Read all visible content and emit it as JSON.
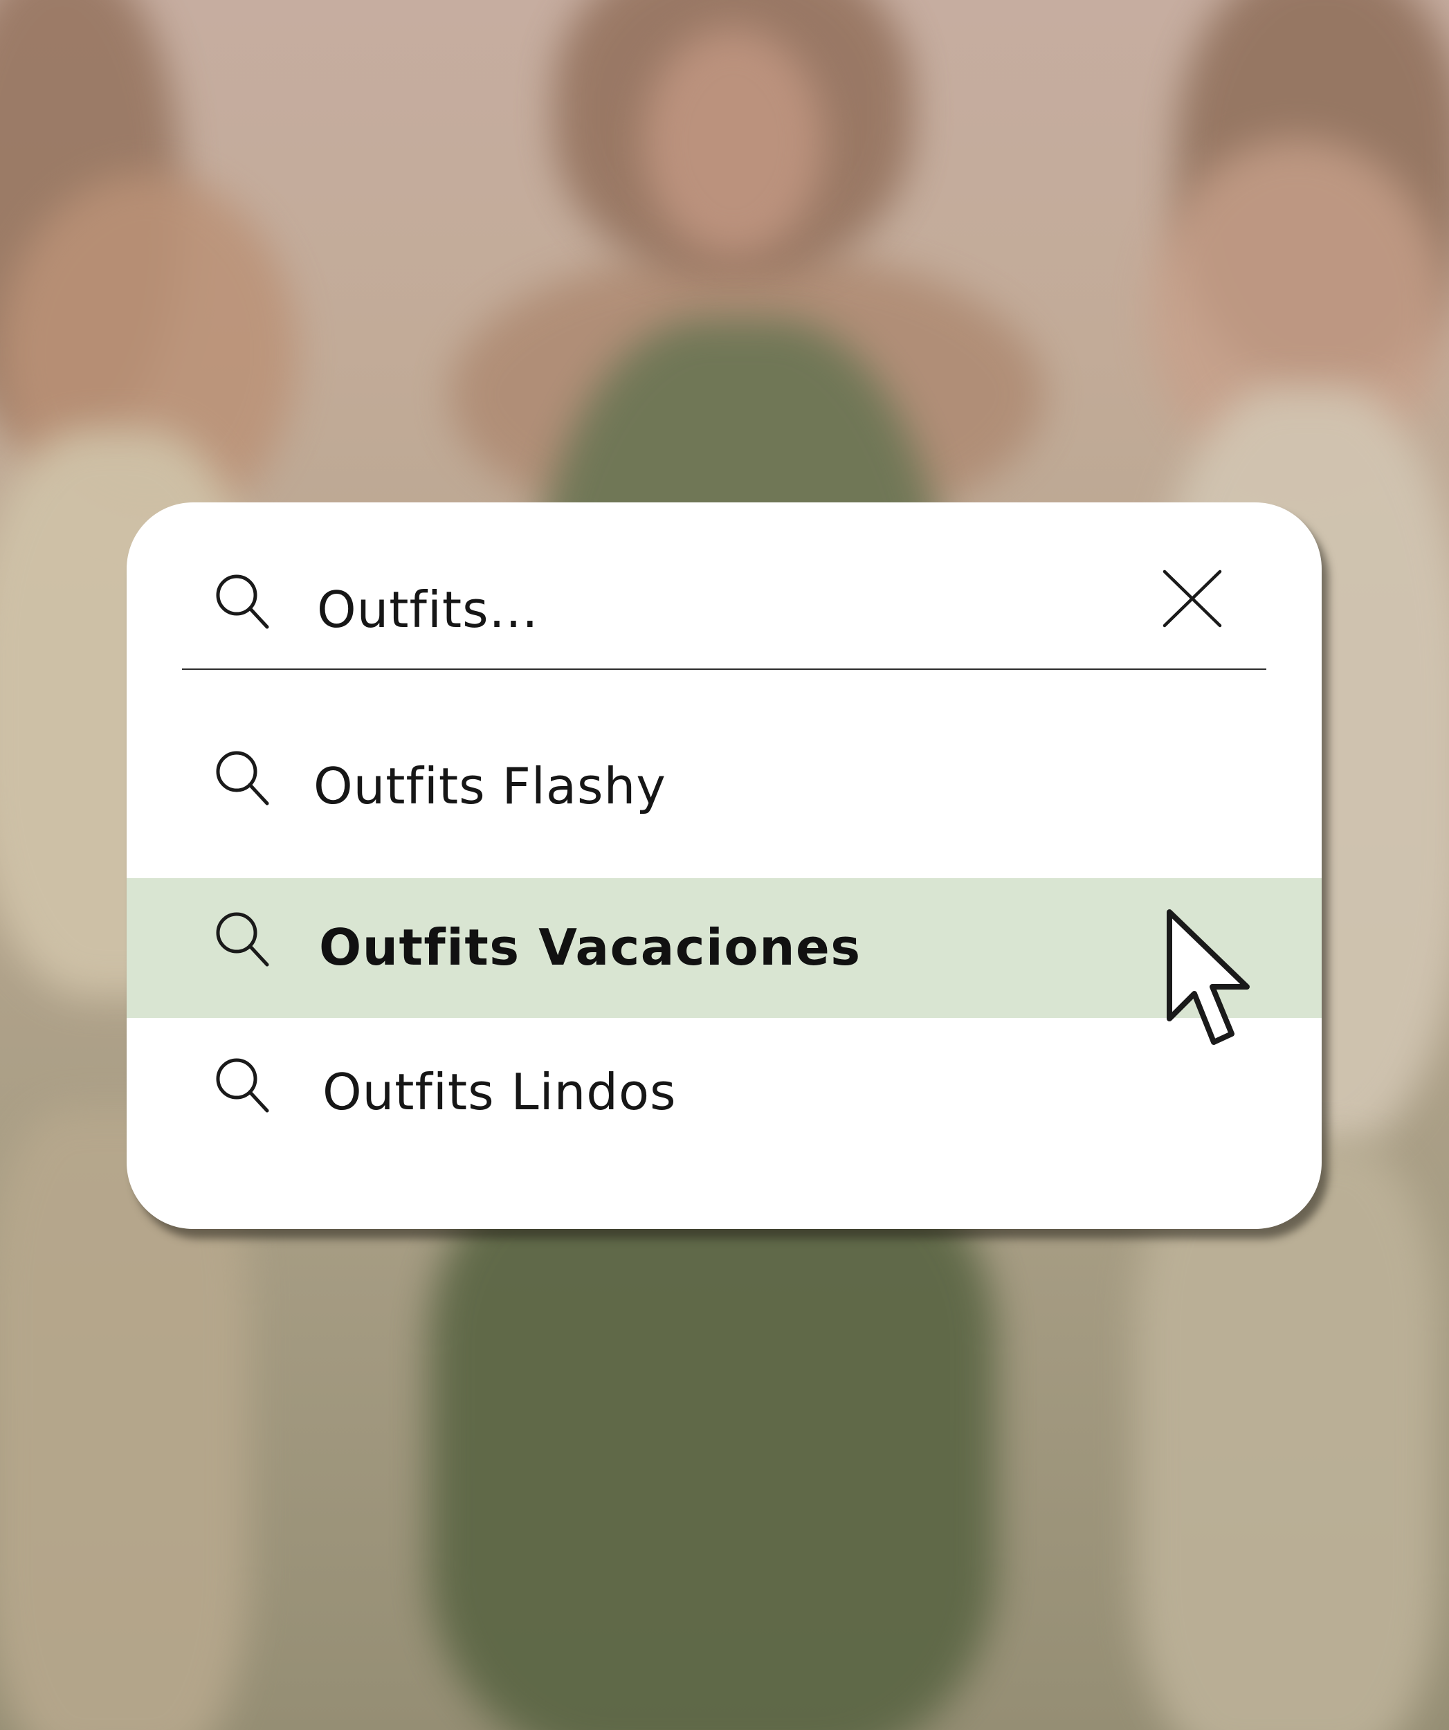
{
  "search": {
    "value": "Outfits...",
    "icon": "search-icon",
    "clear_icon": "close-icon"
  },
  "suggestions": [
    {
      "label": "Outfits Flashy",
      "icon": "search-icon",
      "highlighted": false
    },
    {
      "label": "Outfits Vacaciones",
      "icon": "search-icon",
      "highlighted": true
    },
    {
      "label": "Outfits Lindos",
      "icon": "search-icon",
      "highlighted": false
    }
  ],
  "colors": {
    "highlight": "#d9e5d2",
    "card": "#ffffff",
    "text": "#161616"
  },
  "cursor": {
    "icon": "arrow-cursor-icon"
  }
}
